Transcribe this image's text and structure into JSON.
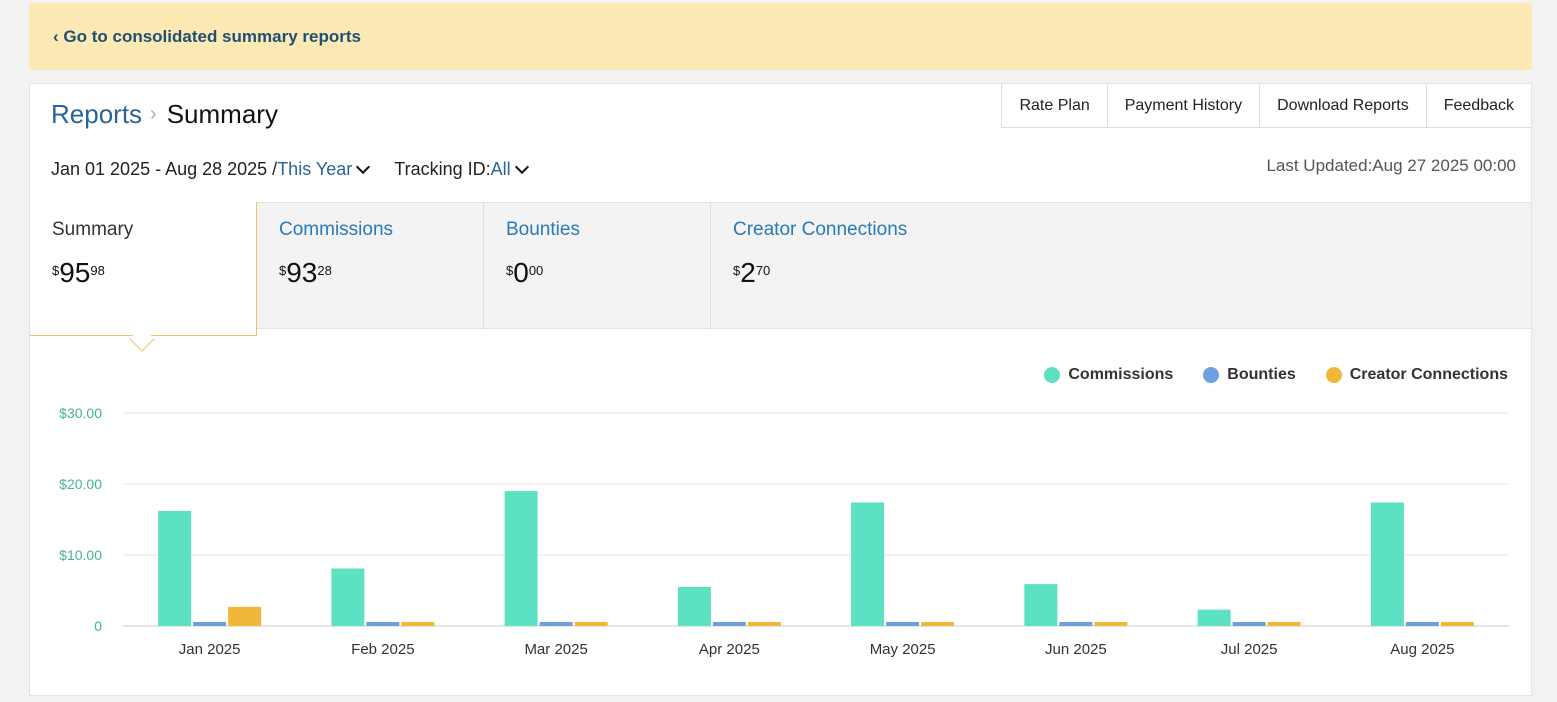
{
  "banner": {
    "link_text": "‹ Go to consolidated summary reports"
  },
  "breadcrumb": {
    "parent": "Reports",
    "separator": "›",
    "current": "Summary"
  },
  "toolbar": {
    "rate_plan": "Rate Plan",
    "payment_history": "Payment History",
    "download_reports": "Download Reports",
    "feedback": "Feedback"
  },
  "filters": {
    "date_range": "Jan 01 2025 - Aug 28 2025 /",
    "period": "This Year",
    "tracking_label": "Tracking ID:",
    "tracking_value": "All"
  },
  "last_updated": "Last Updated:Aug 27 2025 00:00",
  "tabs": [
    {
      "label": "Summary",
      "currency": "$",
      "whole": "95",
      "fraction": "98",
      "active": true
    },
    {
      "label": "Commissions",
      "currency": "$",
      "whole": "93",
      "fraction": "28"
    },
    {
      "label": "Bounties",
      "currency": "$",
      "whole": "0",
      "fraction": "00"
    },
    {
      "label": "Creator Connections",
      "currency": "$",
      "whole": "2",
      "fraction": "70"
    }
  ],
  "colors": {
    "commissions": "#5ce1c2",
    "bounties": "#6f9fe0",
    "creator_connections": "#f0b73a",
    "link": "#2a7ab5"
  },
  "chart_data": {
    "type": "bar",
    "categories": [
      "Jan 2025",
      "Feb 2025",
      "Mar 2025",
      "Apr 2025",
      "May 2025",
      "Jun 2025",
      "Jul 2025",
      "Aug 2025"
    ],
    "series": [
      {
        "name": "Commissions",
        "values": [
          16.2,
          8.1,
          19.0,
          5.5,
          17.4,
          5.9,
          2.3,
          17.4
        ]
      },
      {
        "name": "Bounties",
        "values": [
          0,
          0,
          0,
          0,
          0,
          0,
          0,
          0
        ]
      },
      {
        "name": "Creator Connections",
        "values": [
          2.7,
          0,
          0,
          0,
          0,
          0,
          0,
          0
        ]
      }
    ],
    "yticks": [
      "0",
      "$10.00",
      "$20.00",
      "$30.00"
    ],
    "ylim": [
      0,
      30
    ],
    "legend_position": "top-right",
    "grid": true
  }
}
